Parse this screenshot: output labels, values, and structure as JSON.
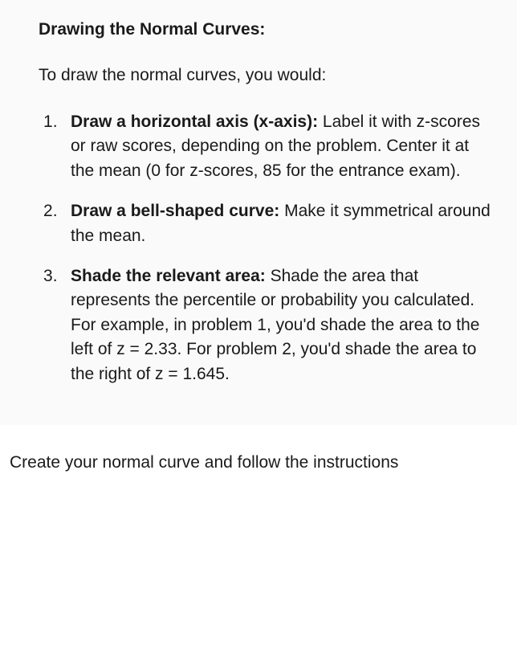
{
  "section": {
    "title": "Drawing the Normal Curves:",
    "intro": "To draw the normal curves, you would:"
  },
  "steps": [
    {
      "bold": "Draw a horizontal axis (x-axis):",
      "text": " Label it with z-scores or raw scores, depending on the problem.  Center it at the mean (0 for z-scores, 85 for the entrance exam)."
    },
    {
      "bold": "Draw a bell-shaped curve:",
      "text": "  Make it symmetrical around the mean."
    },
    {
      "bold": "Shade the relevant area:",
      "text": " Shade the area that represents the percentile or probability you calculated.  For example, in problem 1, you'd shade the area to the left of z = 2.33.  For problem 2, you'd shade the area to the right of z = 1.645."
    }
  ],
  "footer": "Create your normal curve and follow the instructions"
}
